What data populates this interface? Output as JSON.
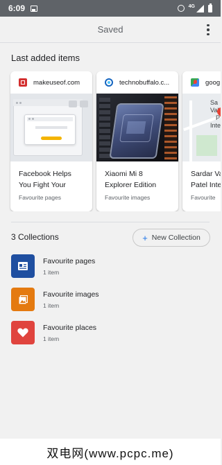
{
  "status_bar": {
    "time": "6:09",
    "network": "4G"
  },
  "app_bar": {
    "title": "Saved"
  },
  "last_added": {
    "title": "Last added items",
    "cards": [
      {
        "source": "makeuseof.com",
        "title": "Facebook Helps You Fight Your",
        "collection": "Favourite pages",
        "favicon_color": "#d32f2f"
      },
      {
        "source": "technobuffalo.c...",
        "title": "Xiaomi Mi 8 Explorer Edition",
        "collection": "Favourite images",
        "favicon_color": "#1565c0"
      },
      {
        "source": "goog",
        "title": "Sardar Va Patel Inte",
        "collection": "Favourite",
        "favicon_color": "#34a853"
      }
    ]
  },
  "collections": {
    "count_label": "3 Collections",
    "new_button_label": "New Collection",
    "items": [
      {
        "name": "Favourite pages",
        "count": "1 item",
        "color": "#1f4fa0",
        "icon": "page-icon"
      },
      {
        "name": "Favourite images",
        "count": "1 item",
        "color": "#e47a10",
        "icon": "image-icon"
      },
      {
        "name": "Favourite places",
        "count": "1 item",
        "color": "#e0443e",
        "icon": "heart-icon"
      }
    ]
  },
  "map_labels": {
    "line1": "Sa",
    "line2": "Valle",
    "line3": "P",
    "line4": "Intern"
  },
  "watermark": "双电网(www.pcpc.me)"
}
